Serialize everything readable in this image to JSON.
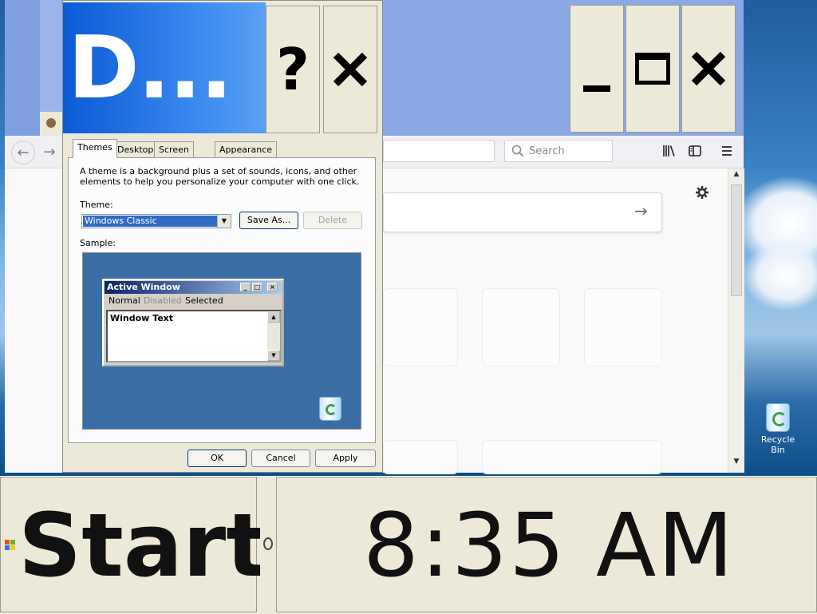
{
  "desktop": {
    "recycle_bin_label": "Recycle Bin"
  },
  "browser": {
    "search_placeholder": "Search",
    "icons": [
      "back-arrow-icon",
      "forward-arrow-icon",
      "search-icon",
      "library-icon",
      "sidebar-icon",
      "menu-icon",
      "settings-gear-icon",
      "go-arrow-icon"
    ],
    "window_buttons": {
      "minimize": "_",
      "maximize": "□",
      "close": "✕"
    }
  },
  "dialog": {
    "title": "D...",
    "help_button": "?",
    "close_button": "✕",
    "tabs": [
      "Themes",
      "Desktop",
      "Screen Saver",
      "Appearance"
    ],
    "active_tab": "Themes",
    "description": "A theme is a background plus a set of sounds, icons, and other elements to help you personalize your computer with one click.",
    "theme_label": "Theme:",
    "theme_value": "Windows Classic",
    "save_as_button": "Save As...",
    "delete_button": "Delete",
    "sample_label": "Sample:",
    "sample": {
      "window_title": "Active Window",
      "menu_normal": "Normal",
      "menu_disabled": "Disabled",
      "menu_selected": "Selected",
      "window_text": "Window Text"
    },
    "ok_button": "OK",
    "cancel_button": "Cancel",
    "apply_button": "Apply"
  },
  "taskbar": {
    "start_label": "Start",
    "clock": "8:35 AM"
  }
}
